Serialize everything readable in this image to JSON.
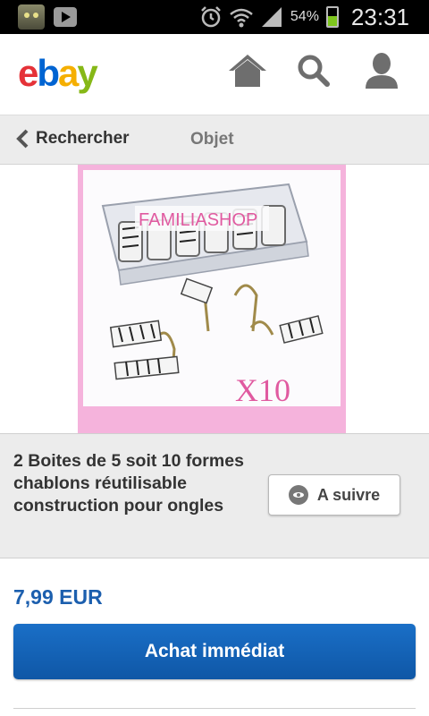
{
  "status_bar": {
    "battery_percent": "54%",
    "battery_level": 0.54,
    "time": "23:31",
    "icons": [
      "talking-cat-app-icon",
      "play-store-icon",
      "alarm-icon",
      "wifi-icon",
      "signal-icon",
      "battery-icon"
    ]
  },
  "header": {
    "logo": {
      "e": "e",
      "b": "b",
      "a": "a",
      "y": "y"
    },
    "logo_colors": {
      "e": "#e53238",
      "b": "#0064d2",
      "a": "#f5af02",
      "y": "#86b817"
    },
    "icons": [
      "home-icon",
      "search-icon",
      "user-icon"
    ]
  },
  "nav": {
    "back_label": "Rechercher",
    "title": "Objet"
  },
  "image": {
    "watermark": "FAMILIASHOP",
    "quantity_label": "X10",
    "frame_color": "#f5b3dc"
  },
  "item": {
    "title": "2 Boites de 5 soit 10 formes chablons réutilisable construction pour ongles",
    "follow_label": "A suivre",
    "price": "7,99 EUR",
    "buy_label": "Achat immédiat"
  },
  "colors": {
    "price": "#1c5fae",
    "buy_button": "#1566bb"
  }
}
